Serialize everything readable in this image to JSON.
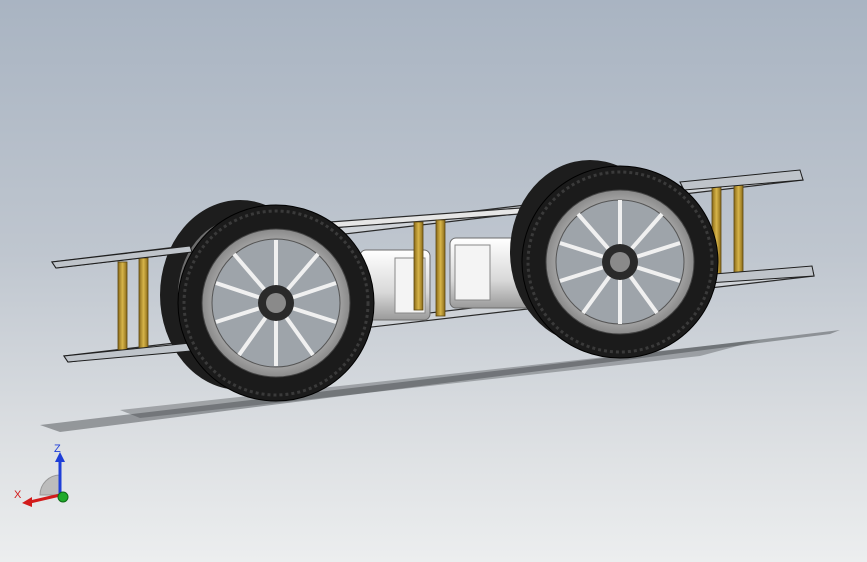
{
  "viewport": {
    "background_top": "#a9b4c2",
    "background_bottom": "#eceeef"
  },
  "triad": {
    "z_label": "Z",
    "x_label": "X",
    "colors": {
      "z": "#1f3fd8",
      "x": "#d21b1b",
      "y": "#1faa2a"
    }
  },
  "model": {
    "parts": [
      "chassis-plate-top",
      "chassis-plate-bottom",
      "standoff",
      "motor",
      "wheel",
      "tire",
      "hub"
    ],
    "colors": {
      "standoff": "#c9a33a",
      "tire": "#1d1d1d",
      "rim": "#d8d8d8",
      "motor": "#e4e4e4"
    }
  }
}
